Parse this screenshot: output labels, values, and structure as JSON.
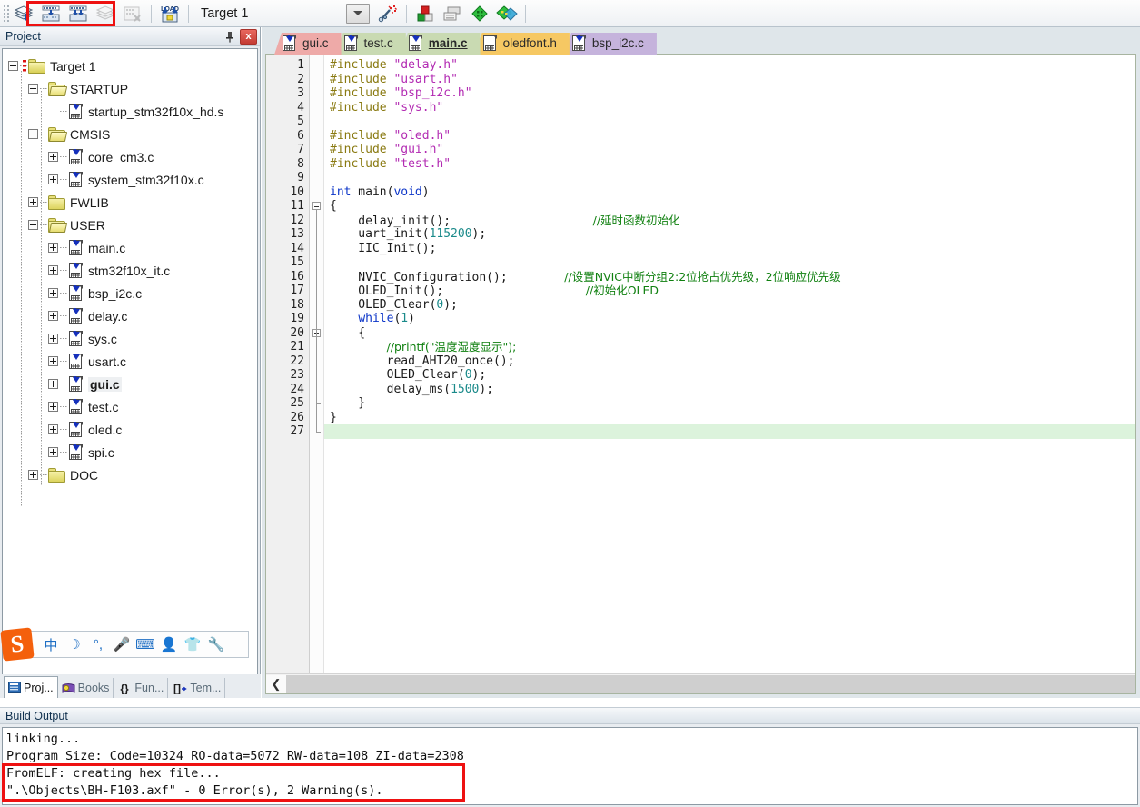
{
  "window": {
    "target_label": "Target 1",
    "accent_highlight": "#ee1111"
  },
  "toolbar": {
    "buttons": [
      {
        "name": "translate-icon",
        "label": "Translate",
        "state": "enabled"
      },
      {
        "name": "build-icon",
        "label": "Build",
        "state": "enabled"
      },
      {
        "name": "rebuild-icon",
        "label": "Rebuild",
        "state": "enabled"
      },
      {
        "name": "batch-build-icon",
        "label": "Batch Build",
        "state": "disabled"
      },
      {
        "name": "stop-build-icon",
        "label": "Stop Build",
        "state": "disabled"
      },
      {
        "name": "download-icon",
        "label": "LOAD",
        "state": "enabled"
      }
    ],
    "load_text": "LOAD",
    "target_label": "Target 1",
    "right_buttons": [
      {
        "name": "target-options-icon",
        "label": "Options for Target"
      },
      {
        "name": "manage-project-items-icon",
        "label": "Manage Project Items"
      },
      {
        "name": "manage-run-time-env-icon",
        "label": "Manage Run-Time Environment"
      },
      {
        "name": "pack-installer-icon",
        "label": "Pack Installer"
      }
    ]
  },
  "project_panel": {
    "title": "Project",
    "pin_label": "Auto Hide",
    "close_label": "x",
    "tree": [
      {
        "label": "Target 1",
        "depth": 0,
        "icon": "folder-target",
        "expander": "minus",
        "bold": false,
        "selected": false
      },
      {
        "label": "STARTUP",
        "depth": 1,
        "icon": "folder-open",
        "expander": "minus",
        "bold": false,
        "selected": false
      },
      {
        "label": "startup_stm32f10x_hd.s",
        "depth": 2,
        "icon": "file-asm",
        "expander": "none",
        "bold": false,
        "selected": false
      },
      {
        "label": "CMSIS",
        "depth": 1,
        "icon": "folder-open",
        "expander": "minus",
        "bold": false,
        "selected": false
      },
      {
        "label": "core_cm3.c",
        "depth": 2,
        "icon": "file-c",
        "expander": "plus",
        "bold": false,
        "selected": false
      },
      {
        "label": "system_stm32f10x.c",
        "depth": 2,
        "icon": "file-c",
        "expander": "plus",
        "bold": false,
        "selected": false
      },
      {
        "label": "FWLIB",
        "depth": 1,
        "icon": "folder-closed",
        "expander": "plus",
        "bold": false,
        "selected": false
      },
      {
        "label": "USER",
        "depth": 1,
        "icon": "folder-open",
        "expander": "minus",
        "bold": false,
        "selected": false
      },
      {
        "label": "main.c",
        "depth": 2,
        "icon": "file-c",
        "expander": "plus",
        "bold": false,
        "selected": false
      },
      {
        "label": "stm32f10x_it.c",
        "depth": 2,
        "icon": "file-c",
        "expander": "plus",
        "bold": false,
        "selected": false
      },
      {
        "label": "bsp_i2c.c",
        "depth": 2,
        "icon": "file-c",
        "expander": "plus",
        "bold": false,
        "selected": false
      },
      {
        "label": "delay.c",
        "depth": 2,
        "icon": "file-c",
        "expander": "plus",
        "bold": false,
        "selected": false
      },
      {
        "label": "sys.c",
        "depth": 2,
        "icon": "file-c",
        "expander": "plus",
        "bold": false,
        "selected": false
      },
      {
        "label": "usart.c",
        "depth": 2,
        "icon": "file-c",
        "expander": "plus",
        "bold": false,
        "selected": false
      },
      {
        "label": "gui.c",
        "depth": 2,
        "icon": "file-c",
        "expander": "plus",
        "bold": true,
        "selected": true
      },
      {
        "label": "test.c",
        "depth": 2,
        "icon": "file-c",
        "expander": "plus",
        "bold": false,
        "selected": false
      },
      {
        "label": "oled.c",
        "depth": 2,
        "icon": "file-c",
        "expander": "plus",
        "bold": false,
        "selected": false
      },
      {
        "label": "spi.c",
        "depth": 2,
        "icon": "file-c",
        "expander": "plus",
        "bold": false,
        "selected": false
      },
      {
        "label": "DOC",
        "depth": 1,
        "icon": "folder-closed",
        "expander": "plus",
        "bold": false,
        "selected": false
      }
    ]
  },
  "ime_bar": {
    "logo": "S",
    "icons": [
      {
        "name": "chinese-mode-icon",
        "glyph": "中"
      },
      {
        "name": "moon-icon",
        "glyph": "☽"
      },
      {
        "name": "punctuation-icon",
        "glyph": "°,"
      },
      {
        "name": "voice-input-icon",
        "glyph": "🎤"
      },
      {
        "name": "soft-keyboard-icon",
        "glyph": "⌨"
      },
      {
        "name": "user-profile-icon",
        "glyph": "👤"
      },
      {
        "name": "skin-icon",
        "glyph": "👕"
      },
      {
        "name": "settings-wrench-icon",
        "glyph": "🔧"
      }
    ]
  },
  "panel_tabs": [
    {
      "label": "Proj...",
      "icon": "project-icon",
      "active": true
    },
    {
      "label": "Books",
      "icon": "books-icon",
      "active": false
    },
    {
      "label": "Fun...",
      "icon": "functions-icon",
      "active": false
    },
    {
      "label": "Tem...",
      "icon": "templates-icon",
      "active": false
    }
  ],
  "editor_tabs": [
    {
      "label": "gui.c",
      "color": "#eeaaa8",
      "active": false,
      "icon": "file-c-icon"
    },
    {
      "label": "test.c",
      "color": "#c9dab2",
      "active": false,
      "icon": "file-c-icon"
    },
    {
      "label": "main.c",
      "color": "#c9dab2",
      "active": true,
      "icon": "file-c-icon"
    },
    {
      "label": "oledfont.h",
      "color": "#f6c863",
      "active": false,
      "icon": "file-h-icon"
    },
    {
      "label": "bsp_i2c.c",
      "color": "#c5b3dc",
      "active": false,
      "icon": "file-c-icon"
    }
  ],
  "code": {
    "first_line": 1,
    "last_line": 27,
    "highlighted_line": 27,
    "fold_markers": [
      11,
      20
    ],
    "lines": [
      {
        "n": 1,
        "tokens": [
          {
            "t": "#include ",
            "c": "pp"
          },
          {
            "t": "\"delay.h\"",
            "c": "st"
          }
        ]
      },
      {
        "n": 2,
        "tokens": [
          {
            "t": "#include ",
            "c": "pp"
          },
          {
            "t": "\"usart.h\"",
            "c": "st"
          }
        ]
      },
      {
        "n": 3,
        "tokens": [
          {
            "t": "#include ",
            "c": "pp"
          },
          {
            "t": "\"bsp_i2c.h\"",
            "c": "st"
          }
        ]
      },
      {
        "n": 4,
        "tokens": [
          {
            "t": "#include ",
            "c": "pp"
          },
          {
            "t": "\"sys.h\"",
            "c": "st"
          }
        ]
      },
      {
        "n": 5,
        "tokens": []
      },
      {
        "n": 6,
        "tokens": [
          {
            "t": "#include ",
            "c": "pp"
          },
          {
            "t": "\"oled.h\"",
            "c": "st"
          }
        ]
      },
      {
        "n": 7,
        "tokens": [
          {
            "t": "#include ",
            "c": "pp"
          },
          {
            "t": "\"gui.h\"",
            "c": "st"
          }
        ]
      },
      {
        "n": 8,
        "tokens": [
          {
            "t": "#include ",
            "c": "pp"
          },
          {
            "t": "\"test.h\"",
            "c": "st"
          }
        ]
      },
      {
        "n": 9,
        "tokens": []
      },
      {
        "n": 10,
        "tokens": [
          {
            "t": "int",
            "c": "k"
          },
          {
            "t": " main(",
            "c": ""
          },
          {
            "t": "void",
            "c": "k"
          },
          {
            "t": ")",
            "c": ""
          }
        ]
      },
      {
        "n": 11,
        "tokens": [
          {
            "t": "{",
            "c": ""
          }
        ]
      },
      {
        "n": 12,
        "tokens": [
          {
            "t": "    delay_init();",
            "c": ""
          },
          {
            "t": "                    ",
            "c": ""
          },
          {
            "t": "//延时函数初始化",
            "c": "cmz"
          }
        ]
      },
      {
        "n": 13,
        "tokens": [
          {
            "t": "    uart_init(",
            "c": ""
          },
          {
            "t": "115200",
            "c": "nm"
          },
          {
            "t": ");",
            "c": ""
          }
        ]
      },
      {
        "n": 14,
        "tokens": [
          {
            "t": "    IIC_Init();",
            "c": ""
          }
        ]
      },
      {
        "n": 15,
        "tokens": []
      },
      {
        "n": 16,
        "tokens": [
          {
            "t": "    NVIC_Configuration();",
            "c": ""
          },
          {
            "t": "        ",
            "c": ""
          },
          {
            "t": "//设置NVIC中断分组2:2位抢占优先级，2位响应优先级",
            "c": "cmz"
          }
        ]
      },
      {
        "n": 17,
        "tokens": [
          {
            "t": "    OLED_Init();",
            "c": ""
          },
          {
            "t": "                    ",
            "c": ""
          },
          {
            "t": "//初始化OLED",
            "c": "cmz"
          }
        ]
      },
      {
        "n": 18,
        "tokens": [
          {
            "t": "    OLED_Clear(",
            "c": ""
          },
          {
            "t": "0",
            "c": "nm"
          },
          {
            "t": ");",
            "c": ""
          }
        ]
      },
      {
        "n": 19,
        "tokens": [
          {
            "t": "    ",
            "c": ""
          },
          {
            "t": "while",
            "c": "k"
          },
          {
            "t": "(",
            "c": ""
          },
          {
            "t": "1",
            "c": "nm"
          },
          {
            "t": ")",
            "c": ""
          }
        ]
      },
      {
        "n": 20,
        "tokens": [
          {
            "t": "    {",
            "c": ""
          }
        ]
      },
      {
        "n": 21,
        "tokens": [
          {
            "t": "        ",
            "c": ""
          },
          {
            "t": "//printf(\"温度湿度显示\");",
            "c": "cmz"
          }
        ]
      },
      {
        "n": 22,
        "tokens": [
          {
            "t": "        read_AHT20_once();",
            "c": ""
          }
        ]
      },
      {
        "n": 23,
        "tokens": [
          {
            "t": "        OLED_Clear(",
            "c": ""
          },
          {
            "t": "0",
            "c": "nm"
          },
          {
            "t": ");",
            "c": ""
          }
        ]
      },
      {
        "n": 24,
        "tokens": [
          {
            "t": "        delay_ms(",
            "c": ""
          },
          {
            "t": "1500",
            "c": "nm"
          },
          {
            "t": ");",
            "c": ""
          }
        ]
      },
      {
        "n": 25,
        "tokens": [
          {
            "t": "    }",
            "c": ""
          }
        ]
      },
      {
        "n": 26,
        "tokens": [
          {
            "t": "}",
            "c": ""
          }
        ]
      },
      {
        "n": 27,
        "tokens": []
      }
    ]
  },
  "editor_scrollbar": {
    "left_arrow": "❮"
  },
  "build_output": {
    "title": "Build Output",
    "lines": [
      "linking...",
      "Program Size: Code=10324 RO-data=5072 RW-data=108 ZI-data=2308",
      "FromELF: creating hex file...",
      "\".\\Objects\\BH-F103.axf\" - 0 Error(s), 2 Warning(s)."
    ],
    "program_size": {
      "code": 10324,
      "ro_data": 5072,
      "rw_data": 108,
      "zi_data": 2308
    },
    "output_file": ".\\Objects\\BH-F103.axf",
    "errors": 0,
    "warnings": 2
  }
}
